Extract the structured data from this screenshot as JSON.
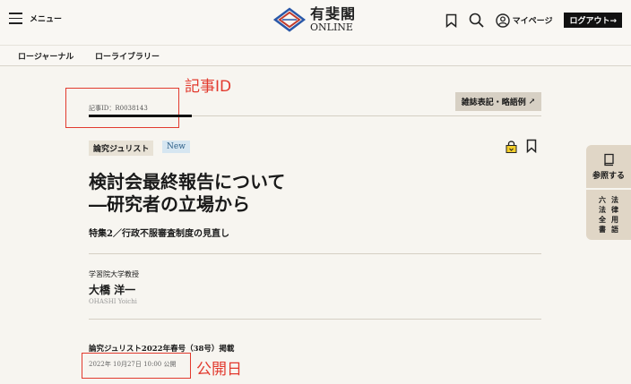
{
  "header": {
    "menu_label": "メニュー",
    "logo_jp": "有斐閣",
    "logo_en": "ONLINE",
    "mypage_label": "マイページ",
    "logout_label": "ログアウト→"
  },
  "subnav": {
    "items": [
      "ロージャーナル",
      "ローライブラリー"
    ]
  },
  "annotations": {
    "article_id_label": "記事ID",
    "published_label": "公開日",
    "color": "#e23a2e"
  },
  "article": {
    "id_text": "記事ID：R0038143",
    "abbr_button": "雑誌表記・略語例",
    "abbr_arrow": "↗",
    "category_badge": "論究ジュリスト",
    "new_badge": "New",
    "title_line1": "検討会最終報告について",
    "title_line2": "―研究者の立場から",
    "subtitle": "特集2／行政不服審査制度の見直し",
    "affiliation": "学習院大学教授",
    "author": "大橋 洋一",
    "author_roman": "OHASHI Yoichi",
    "publication": "論究ジュリスト2022年春号（38号）掲載",
    "published_date": "2022年 10月27日 10:00 公開"
  },
  "side_panel": {
    "reference_label": "参照する",
    "law_col1": [
      "六",
      "法",
      "全",
      "書"
    ],
    "law_col2": [
      "法",
      "律",
      "用",
      "語"
    ]
  },
  "icons": [
    "hamburger-icon",
    "logo-mark-icon",
    "bookmark-icon",
    "search-icon",
    "user-icon",
    "lock-icon",
    "book-icon",
    "external-link-icon"
  ]
}
